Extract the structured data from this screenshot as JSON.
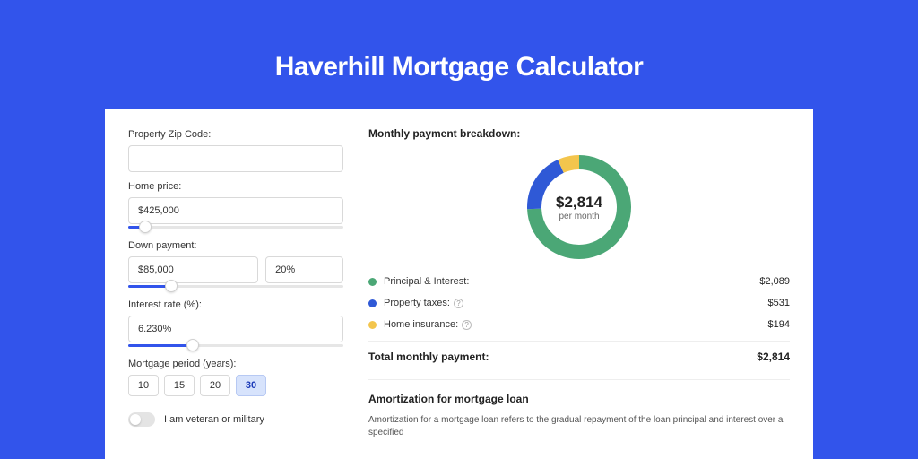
{
  "title": "Haverhill Mortgage Calculator",
  "form": {
    "zip_label": "Property Zip Code:",
    "zip_value": "",
    "price_label": "Home price:",
    "price_value": "$425,000",
    "price_slider_pct": 8,
    "down_label": "Down payment:",
    "down_value": "$85,000",
    "down_pct_value": "20%",
    "down_slider_pct": 20,
    "rate_label": "Interest rate (%):",
    "rate_value": "6.230%",
    "rate_slider_pct": 30,
    "period_label": "Mortgage period (years):",
    "period_options": [
      "10",
      "15",
      "20",
      "30"
    ],
    "period_selected": "30",
    "veteran_label": "I am veteran or military"
  },
  "breakdown": {
    "heading": "Monthly payment breakdown:",
    "center_amount": "$2,814",
    "center_sub": "per month",
    "items": [
      {
        "label": "Principal & Interest:",
        "value": "$2,089",
        "color": "g",
        "info": false
      },
      {
        "label": "Property taxes:",
        "value": "$531",
        "color": "b",
        "info": true
      },
      {
        "label": "Home insurance:",
        "value": "$194",
        "color": "y",
        "info": true
      }
    ],
    "total_label": "Total monthly payment:",
    "total_value": "$2,814"
  },
  "amortization": {
    "heading": "Amortization for mortgage loan",
    "text": "Amortization for a mortgage loan refers to the gradual repayment of the loan principal and interest over a specified"
  },
  "chart_data": {
    "type": "pie",
    "title": "Monthly payment breakdown",
    "series": [
      {
        "name": "Principal & Interest",
        "value": 2089,
        "color": "#4ba776"
      },
      {
        "name": "Property taxes",
        "value": 531,
        "color": "#2f59d6"
      },
      {
        "name": "Home insurance",
        "value": 194,
        "color": "#f3c54d"
      }
    ],
    "total": 2814,
    "unit": "USD per month"
  }
}
